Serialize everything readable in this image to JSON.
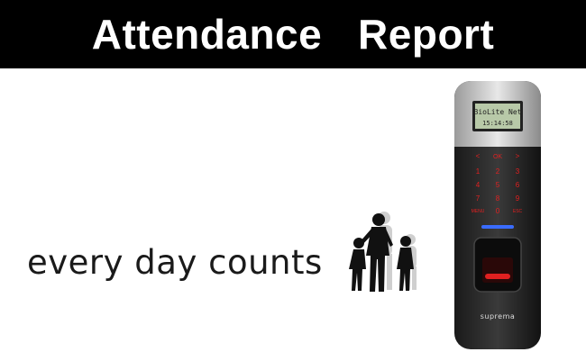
{
  "banner": {
    "title": "Attendance   Report"
  },
  "tagline": {
    "text": "every day counts"
  },
  "device": {
    "screen_line1": "BioLite Net",
    "screen_line2": "15:14:58",
    "nav_left": "<",
    "nav_ok": "OK",
    "nav_right": ">",
    "keys": [
      "1",
      "2",
      "3",
      "4",
      "5",
      "6",
      "7",
      "8",
      "9",
      "MENU",
      "0",
      "ESC"
    ],
    "brand": "suprema"
  },
  "icons": [
    "family-silhouette-icon",
    "fingerprint-sensor-icon"
  ],
  "colors": {
    "banner": "#000000",
    "key_glow": "#e02020",
    "screen": "#b8c9a8",
    "led": "#3a6cff"
  }
}
